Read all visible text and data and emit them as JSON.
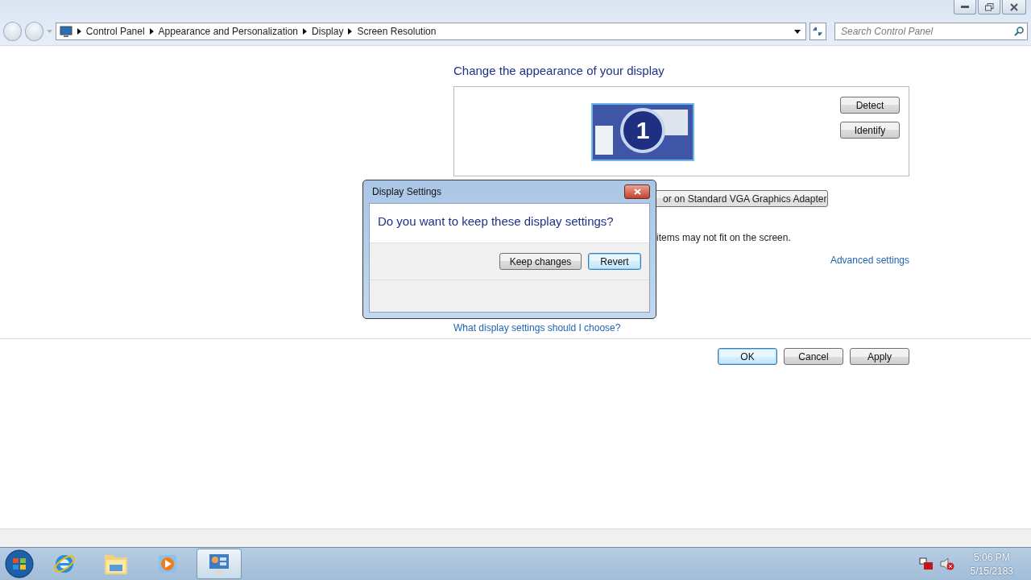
{
  "address_bar": {
    "breadcrumbs": [
      "Control Panel",
      "Appearance and Personalization",
      "Display",
      "Screen Resolution"
    ],
    "search": {
      "placeholder": "Search Control Panel"
    }
  },
  "heading": "Change the appearance of your display",
  "monitor": {
    "label": "1"
  },
  "side_buttons": [
    {
      "label": "Detect"
    },
    {
      "label": "Identify"
    }
  ],
  "display_dropdown": "or on Standard VGA Graphics Adapter",
  "note": "items may not fit on the screen.",
  "advanced_link": "Advanced settings",
  "help_link": "What display settings should I choose?",
  "footer_buttons": [
    {
      "label": "OK",
      "default": true
    },
    {
      "label": "Cancel",
      "default": false
    },
    {
      "label": "Apply",
      "default": false
    }
  ],
  "dialog": {
    "title": "Display Settings",
    "question": "Do you want to keep these display settings?",
    "buttons": [
      {
        "label": "Keep changes",
        "default": false
      },
      {
        "label": "Revert",
        "default": true
      }
    ]
  },
  "taskbar": {
    "items": [
      {
        "kind": "browser",
        "selected": false
      },
      {
        "kind": "folder",
        "selected": false
      },
      {
        "kind": "media",
        "selected": false
      },
      {
        "kind": "control",
        "selected": true
      }
    ],
    "time": "5:06 PM",
    "date": "5/15/2183"
  }
}
